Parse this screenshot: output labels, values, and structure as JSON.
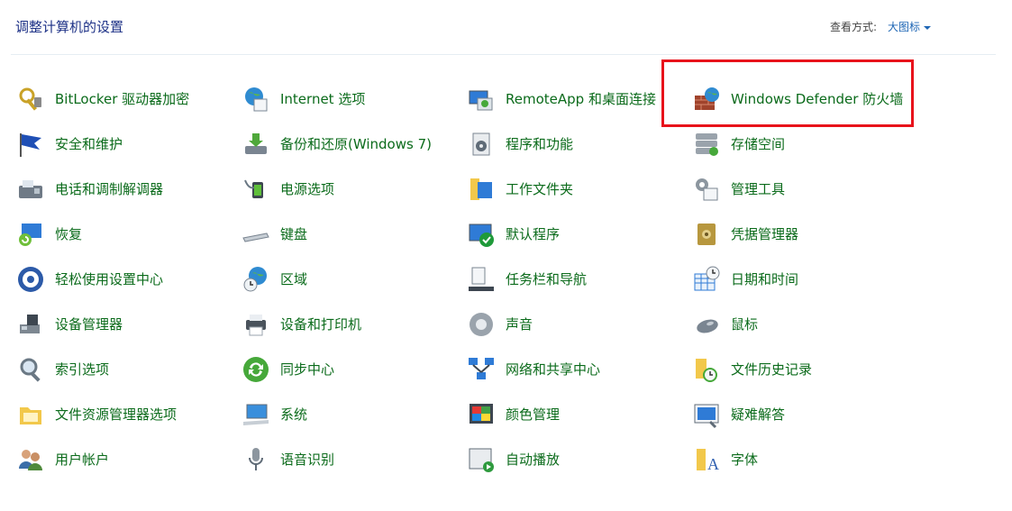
{
  "header": {
    "title": "调整计算机的设置",
    "view_by_label": "查看方式:",
    "view_by_value": "大图标"
  },
  "columns": [
    [
      {
        "label": "BitLocker 驱动器加密",
        "icon": "bitlocker-key-icon"
      },
      {
        "label": "安全和维护",
        "icon": "flag-icon"
      },
      {
        "label": "电话和调制解调器",
        "icon": "fax-phone-icon"
      },
      {
        "label": "恢复",
        "icon": "recovery-monitor-icon"
      },
      {
        "label": "轻松使用设置中心",
        "icon": "ease-of-access-icon"
      },
      {
        "label": "设备管理器",
        "icon": "device-manager-icon"
      },
      {
        "label": "索引选项",
        "icon": "magnifier-icon"
      },
      {
        "label": "文件资源管理器选项",
        "icon": "folder-options-icon"
      },
      {
        "label": "用户帐户",
        "icon": "users-icon"
      }
    ],
    [
      {
        "label": "Internet 选项",
        "icon": "globe-icon"
      },
      {
        "label": "备份和还原(Windows 7)",
        "icon": "backup-icon"
      },
      {
        "label": "电源选项",
        "icon": "power-plug-icon"
      },
      {
        "label": "键盘",
        "icon": "keyboard-icon"
      },
      {
        "label": "区域",
        "icon": "region-globe-icon"
      },
      {
        "label": "设备和打印机",
        "icon": "printer-icon"
      },
      {
        "label": "同步中心",
        "icon": "sync-icon"
      },
      {
        "label": "系统",
        "icon": "system-monitor-icon"
      },
      {
        "label": "语音识别",
        "icon": "microphone-icon"
      }
    ],
    [
      {
        "label": "RemoteApp 和桌面连接",
        "icon": "remoteapp-icon"
      },
      {
        "label": "程序和功能",
        "icon": "programs-icon"
      },
      {
        "label": "工作文件夹",
        "icon": "work-folder-icon"
      },
      {
        "label": "默认程序",
        "icon": "default-programs-icon"
      },
      {
        "label": "任务栏和导航",
        "icon": "taskbar-icon"
      },
      {
        "label": "声音",
        "icon": "speaker-icon"
      },
      {
        "label": "网络和共享中心",
        "icon": "network-icon"
      },
      {
        "label": "颜色管理",
        "icon": "color-management-icon"
      },
      {
        "label": "自动播放",
        "icon": "autoplay-icon"
      }
    ],
    [
      {
        "label": "Windows Defender 防火墙",
        "icon": "firewall-icon"
      },
      {
        "label": "存储空间",
        "icon": "storage-icon"
      },
      {
        "label": "管理工具",
        "icon": "admin-tools-icon"
      },
      {
        "label": "凭据管理器",
        "icon": "credential-safe-icon"
      },
      {
        "label": "日期和时间",
        "icon": "calendar-clock-icon"
      },
      {
        "label": "鼠标",
        "icon": "mouse-icon"
      },
      {
        "label": "文件历史记录",
        "icon": "file-history-icon"
      },
      {
        "label": "疑难解答",
        "icon": "troubleshoot-icon"
      },
      {
        "label": "字体",
        "icon": "fonts-icon"
      }
    ]
  ],
  "colors": {
    "title": "#1e3287",
    "link_green": "#0b6b1b",
    "highlight_red": "#e8121b"
  }
}
